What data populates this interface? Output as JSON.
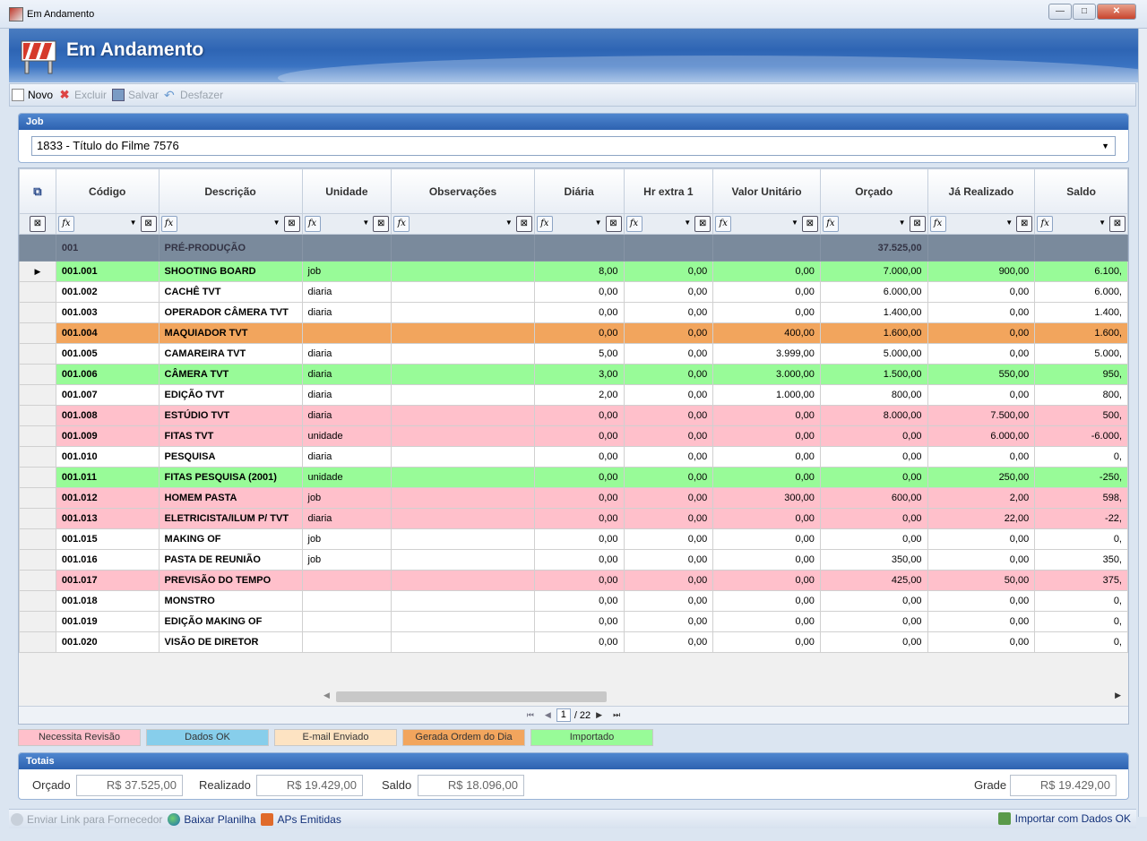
{
  "window": {
    "title": "Em Andamento",
    "minimize": "—",
    "maximize": "□",
    "close": "✕"
  },
  "banner": {
    "title": "Em Andamento"
  },
  "toolbar": {
    "new_label": "Novo",
    "delete_label": "Excluir",
    "save_label": "Salvar",
    "undo_label": "Desfazer"
  },
  "job": {
    "header": "Job",
    "selected": "1833 - Título do Filme 7576"
  },
  "grid": {
    "columns": [
      "Código",
      "Descrição",
      "Unidade",
      "Observações",
      "Diária",
      "Hr extra 1",
      "Valor Unitário",
      "Orçado",
      "Já Realizado",
      "Saldo"
    ],
    "group": {
      "code": "001",
      "description": "PRÉ-PRODUÇÃO",
      "orcado": "37.525,00"
    },
    "rows": [
      {
        "code": "001.001",
        "desc": "SHOOTING BOARD",
        "unit": "job",
        "obs": "",
        "diaria": "8,00",
        "hr": "0,00",
        "vu": "0,00",
        "orcado": "7.000,00",
        "real": "900,00",
        "saldo": "6.100,",
        "color": "green"
      },
      {
        "code": "001.002",
        "desc": "CACHÊ TVT",
        "unit": "diaria",
        "obs": "",
        "diaria": "0,00",
        "hr": "0,00",
        "vu": "0,00",
        "orcado": "6.000,00",
        "real": "0,00",
        "saldo": "6.000,",
        "color": "white"
      },
      {
        "code": "001.003",
        "desc": "OPERADOR CÂMERA TVT",
        "unit": "diaria",
        "obs": "",
        "diaria": "0,00",
        "hr": "0,00",
        "vu": "0,00",
        "orcado": "1.400,00",
        "real": "0,00",
        "saldo": "1.400,",
        "color": "white"
      },
      {
        "code": "001.004",
        "desc": "MAQUIADOR TVT",
        "unit": "",
        "obs": "",
        "diaria": "0,00",
        "hr": "0,00",
        "vu": "400,00",
        "orcado": "1.600,00",
        "real": "0,00",
        "saldo": "1.600,",
        "color": "orange"
      },
      {
        "code": "001.005",
        "desc": "CAMAREIRA TVT",
        "unit": "diaria",
        "obs": "",
        "diaria": "5,00",
        "hr": "0,00",
        "vu": "3.999,00",
        "orcado": "5.000,00",
        "real": "0,00",
        "saldo": "5.000,",
        "color": "white"
      },
      {
        "code": "001.006",
        "desc": "CÂMERA TVT",
        "unit": "diaria",
        "obs": "",
        "diaria": "3,00",
        "hr": "0,00",
        "vu": "3.000,00",
        "orcado": "1.500,00",
        "real": "550,00",
        "saldo": "950,",
        "color": "green"
      },
      {
        "code": "001.007",
        "desc": "EDIÇÃO TVT",
        "unit": "diaria",
        "obs": "",
        "diaria": "2,00",
        "hr": "0,00",
        "vu": "1.000,00",
        "orcado": "800,00",
        "real": "0,00",
        "saldo": "800,",
        "color": "white"
      },
      {
        "code": "001.008",
        "desc": "ESTÚDIO TVT",
        "unit": "diaria",
        "obs": "",
        "diaria": "0,00",
        "hr": "0,00",
        "vu": "0,00",
        "orcado": "8.000,00",
        "real": "7.500,00",
        "saldo": "500,",
        "color": "pink"
      },
      {
        "code": "001.009",
        "desc": "FITAS TVT",
        "unit": "unidade",
        "obs": "",
        "diaria": "0,00",
        "hr": "0,00",
        "vu": "0,00",
        "orcado": "0,00",
        "real": "6.000,00",
        "saldo": "-6.000,",
        "color": "pink"
      },
      {
        "code": "001.010",
        "desc": "PESQUISA",
        "unit": "diaria",
        "obs": "",
        "diaria": "0,00",
        "hr": "0,00",
        "vu": "0,00",
        "orcado": "0,00",
        "real": "0,00",
        "saldo": "0,",
        "color": "white"
      },
      {
        "code": "001.011",
        "desc": "FITAS PESQUISA (2001)",
        "unit": "unidade",
        "obs": "",
        "diaria": "0,00",
        "hr": "0,00",
        "vu": "0,00",
        "orcado": "0,00",
        "real": "250,00",
        "saldo": "-250,",
        "color": "green"
      },
      {
        "code": "001.012",
        "desc": "HOMEM PASTA",
        "unit": "job",
        "obs": "",
        "diaria": "0,00",
        "hr": "0,00",
        "vu": "300,00",
        "orcado": "600,00",
        "real": "2,00",
        "saldo": "598,",
        "color": "pink"
      },
      {
        "code": "001.013",
        "desc": "ELETRICISTA/ILUM P/ TVT",
        "unit": "diaria",
        "obs": "",
        "diaria": "0,00",
        "hr": "0,00",
        "vu": "0,00",
        "orcado": "0,00",
        "real": "22,00",
        "saldo": "-22,",
        "color": "pink"
      },
      {
        "code": "001.015",
        "desc": "MAKING OF",
        "unit": "job",
        "obs": "",
        "diaria": "0,00",
        "hr": "0,00",
        "vu": "0,00",
        "orcado": "0,00",
        "real": "0,00",
        "saldo": "0,",
        "color": "white"
      },
      {
        "code": "001.016",
        "desc": "PASTA DE REUNIÃO",
        "unit": "job",
        "obs": "",
        "diaria": "0,00",
        "hr": "0,00",
        "vu": "0,00",
        "orcado": "350,00",
        "real": "0,00",
        "saldo": "350,",
        "color": "white"
      },
      {
        "code": "001.017",
        "desc": "PREVISÃO DO TEMPO",
        "unit": "",
        "obs": "",
        "diaria": "0,00",
        "hr": "0,00",
        "vu": "0,00",
        "orcado": "425,00",
        "real": "50,00",
        "saldo": "375,",
        "color": "pink"
      },
      {
        "code": "001.018",
        "desc": "MONSTRO",
        "unit": "",
        "obs": "",
        "diaria": "0,00",
        "hr": "0,00",
        "vu": "0,00",
        "orcado": "0,00",
        "real": "0,00",
        "saldo": "0,",
        "color": "white"
      },
      {
        "code": "001.019",
        "desc": "EDIÇÃO MAKING OF",
        "unit": "",
        "obs": "",
        "diaria": "0,00",
        "hr": "0,00",
        "vu": "0,00",
        "orcado": "0,00",
        "real": "0,00",
        "saldo": "0,",
        "color": "white"
      },
      {
        "code": "001.020",
        "desc": "VISÃO DE DIRETOR",
        "unit": "",
        "obs": "",
        "diaria": "0,00",
        "hr": "0,00",
        "vu": "0,00",
        "orcado": "0,00",
        "real": "0,00",
        "saldo": "0,",
        "color": "white"
      }
    ]
  },
  "pager": {
    "page": "1",
    "of": "/ 22"
  },
  "legend": [
    {
      "label": "Necessita Revisão",
      "color": "#ffc0cb"
    },
    {
      "label": "Dados OK",
      "color": "#87ceeb"
    },
    {
      "label": "E-mail Enviado",
      "color": "#fde3c2"
    },
    {
      "label": "Gerada Ordem do Dia",
      "color": "#f2a55d"
    },
    {
      "label": "Importado",
      "color": "#98fb98"
    }
  ],
  "totals": {
    "header": "Totais",
    "orcado_label": "Orçado",
    "orcado_value": "R$ 37.525,00",
    "realizado_label": "Realizado",
    "realizado_value": "R$ 19.429,00",
    "saldo_label": "Saldo",
    "saldo_value": "R$ 18.096,00",
    "grade_label": "Grade",
    "grade_value": "R$ 19.429,00"
  },
  "bottombar": {
    "send_link": "Enviar Link para Fornecedor",
    "download": "Baixar Planilha",
    "aps": "APs Emitidas",
    "import": "Importar com Dados OK"
  }
}
